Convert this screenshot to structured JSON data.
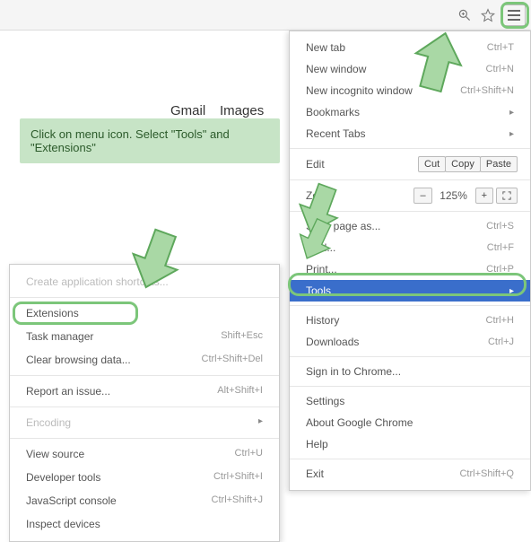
{
  "links": {
    "gmail": "Gmail",
    "images": "Images"
  },
  "instruction": "Click on menu icon. Select \"Tools\" and \"Extensions\"",
  "mainMenu": {
    "newTab": {
      "label": "New tab",
      "shortcut": "Ctrl+T"
    },
    "newWindow": {
      "label": "New window",
      "shortcut": "Ctrl+N"
    },
    "incognito": {
      "label": "New incognito window",
      "shortcut": "Ctrl+Shift+N"
    },
    "bookmarks": {
      "label": "Bookmarks"
    },
    "recentTabs": {
      "label": "Recent Tabs"
    },
    "edit": {
      "label": "Edit",
      "cut": "Cut",
      "copy": "Copy",
      "paste": "Paste"
    },
    "zoom": {
      "label": "Zoom",
      "minus": "–",
      "value": "125%",
      "plus": "+"
    },
    "savePage": {
      "label": "Save page as...",
      "shortcut": "Ctrl+S"
    },
    "find": {
      "label": "Find...",
      "shortcut": "Ctrl+F"
    },
    "print": {
      "label": "Print...",
      "shortcut": "Ctrl+P"
    },
    "tools": {
      "label": "Tools"
    },
    "history": {
      "label": "History",
      "shortcut": "Ctrl+H"
    },
    "downloads": {
      "label": "Downloads",
      "shortcut": "Ctrl+J"
    },
    "signin": {
      "label": "Sign in to Chrome..."
    },
    "settings": {
      "label": "Settings"
    },
    "about": {
      "label": "About Google Chrome"
    },
    "help": {
      "label": "Help"
    },
    "exit": {
      "label": "Exit",
      "shortcut": "Ctrl+Shift+Q"
    }
  },
  "subMenu": {
    "createShortcuts": {
      "label": "Create application shortcuts..."
    },
    "extensions": {
      "label": "Extensions"
    },
    "taskManager": {
      "label": "Task manager",
      "shortcut": "Shift+Esc"
    },
    "clearData": {
      "label": "Clear browsing data...",
      "shortcut": "Ctrl+Shift+Del"
    },
    "reportIssue": {
      "label": "Report an issue...",
      "shortcut": "Alt+Shift+I"
    },
    "encoding": {
      "label": "Encoding"
    },
    "viewSource": {
      "label": "View source",
      "shortcut": "Ctrl+U"
    },
    "devTools": {
      "label": "Developer tools",
      "shortcut": "Ctrl+Shift+I"
    },
    "jsConsole": {
      "label": "JavaScript console",
      "shortcut": "Ctrl+Shift+J"
    },
    "inspectDevices": {
      "label": "Inspect devices"
    }
  }
}
